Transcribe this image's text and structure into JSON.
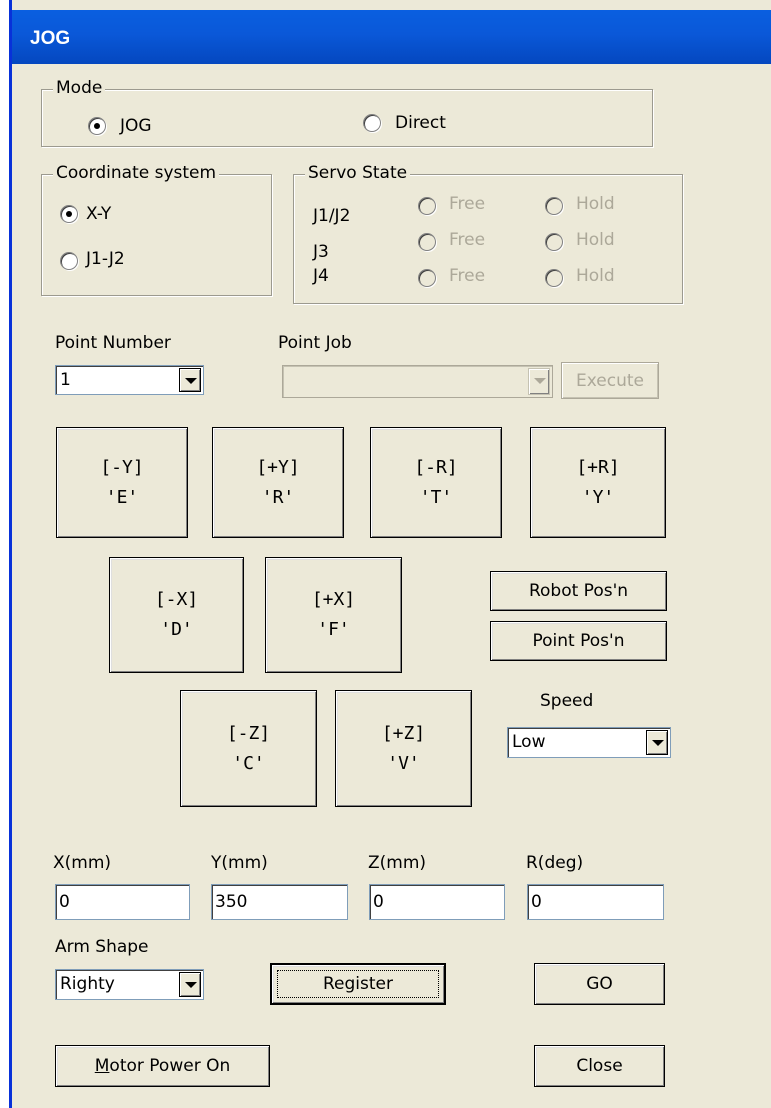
{
  "window": {
    "title": "JOG"
  },
  "mode": {
    "legend": "Mode",
    "options": [
      {
        "label": "JOG",
        "checked": true
      },
      {
        "label": "Direct",
        "checked": false
      }
    ]
  },
  "coordinate_system": {
    "legend": "Coordinate system",
    "options": [
      {
        "label": "X-Y",
        "checked": true
      },
      {
        "label": "J1-J2",
        "checked": false
      }
    ]
  },
  "servo_state": {
    "legend": "Servo State",
    "free_label": "Free",
    "hold_label": "Hold",
    "rows": [
      {
        "joint": "J1/J2"
      },
      {
        "joint": "J3"
      },
      {
        "joint": "J4"
      }
    ]
  },
  "point_number": {
    "label": "Point Number",
    "value": "1"
  },
  "point_job": {
    "label": "Point Job",
    "value": "",
    "execute_label": "Execute"
  },
  "jog_buttons": [
    {
      "axis": "[-Y]",
      "key": "'E'"
    },
    {
      "axis": "[+Y]",
      "key": "'R'"
    },
    {
      "axis": "[-R]",
      "key": "'T'"
    },
    {
      "axis": "[+R]",
      "key": "'Y'"
    },
    {
      "axis": "[-X]",
      "key": "'D'"
    },
    {
      "axis": "[+X]",
      "key": "'F'"
    },
    {
      "axis": "[-Z]",
      "key": "'C'"
    },
    {
      "axis": "[+Z]",
      "key": "'V'"
    }
  ],
  "robot_posn_label": "Robot Pos'n",
  "point_posn_label": "Point Pos'n",
  "speed": {
    "label": "Speed",
    "value": "Low"
  },
  "coords": [
    {
      "label": "X(mm)",
      "value": "0"
    },
    {
      "label": "Y(mm)",
      "value": "350"
    },
    {
      "label": "Z(mm)",
      "value": "0"
    },
    {
      "label": "R(deg)",
      "value": "0"
    }
  ],
  "arm_shape": {
    "label": "Arm Shape",
    "value": "Righty"
  },
  "register_label": "Register",
  "go_label": "GO",
  "motor_power": {
    "mnemonic": "M",
    "rest": "otor Power On"
  },
  "close_label": "Close",
  "colors": {
    "titlebar": "#0a58d8",
    "window_bg": "#ece9d8",
    "disabled_text": "#aca899"
  }
}
